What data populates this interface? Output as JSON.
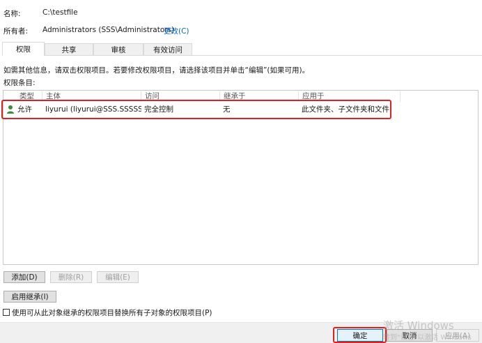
{
  "info": {
    "name_label": "名称:",
    "name_value": "C:\\testfile",
    "owner_label": "所有者:",
    "owner_value": "Administrators (SSS\\Administrators)",
    "change_link": "更改(C)"
  },
  "tabs": [
    {
      "label": "权限",
      "active": true
    },
    {
      "label": "共享",
      "active": false
    },
    {
      "label": "审核",
      "active": false
    },
    {
      "label": "有效访问",
      "active": false
    }
  ],
  "instruction": "如需其他信息，请双击权限项目。若要修改权限项目，请选择该项目并单击“编辑”(如果可用)。",
  "entries_label": "权限条目:",
  "columns": [
    "类型",
    "主体",
    "访问",
    "继承于",
    "应用于"
  ],
  "rows": [
    {
      "icon": "user-icon",
      "type": "允许",
      "principal": "liyurui (liyurui@SSS.SSSSS.S...",
      "access": "完全控制",
      "inherited_from": "无",
      "applies_to": "此文件夹、子文件夹和文件"
    }
  ],
  "buttons": {
    "add": "添加(D)",
    "remove": "删除(R)",
    "edit": "编辑(E)",
    "enable_inheritance": "启用继承(I)"
  },
  "replace_checkbox_label": "使用可从此对象继承的权限项目替换所有子对象的权限项目(P)",
  "footer": {
    "ok": "确定",
    "cancel": "取消",
    "apply": "应用(A)"
  },
  "watermark": {
    "line1": "激活 Windows",
    "line2": "转到\"设置\"以激活 Windows"
  },
  "colors": {
    "highlight": "#e02020",
    "link": "#0066cc",
    "user_icon": "#3c8c3c"
  }
}
